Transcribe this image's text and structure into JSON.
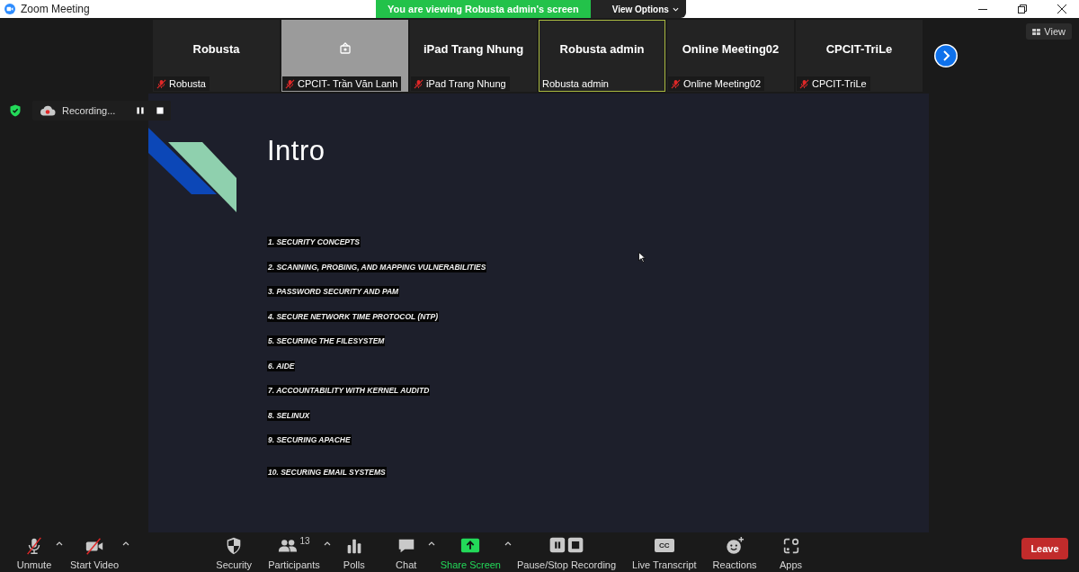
{
  "window": {
    "title": "Zoom Meeting"
  },
  "banner": {
    "message": "You are viewing Robusta admin's screen",
    "options": "View Options"
  },
  "view_button": {
    "label": "View"
  },
  "participants": [
    {
      "kind": "name",
      "name": "Robusta",
      "label": "Robusta",
      "muted": true,
      "speaking": false
    },
    {
      "kind": "video",
      "label": "CPCIT- Trần Văn Lanh",
      "muted": true,
      "speaking": false
    },
    {
      "kind": "name",
      "name": "iPad Trang Nhung",
      "label": "iPad Trang Nhung",
      "muted": true,
      "speaking": false
    },
    {
      "kind": "name",
      "name": "Robusta admin",
      "label": "Robusta admin",
      "muted": false,
      "speaking": true
    },
    {
      "kind": "name",
      "name": "Online Meeting02",
      "label": "Online Meeting02",
      "muted": true,
      "speaking": false
    },
    {
      "kind": "name",
      "name": "CPCIT-TriLe",
      "label": "CPCIT-TriLe",
      "muted": true,
      "speaking": false
    }
  ],
  "recording": {
    "label": "Recording..."
  },
  "slide": {
    "title": "Intro",
    "items": [
      "1. SECURITY CONCEPTS",
      "2. SCANNING, PROBING, AND MAPPING VULNERABILITIES",
      "3. PASSWORD SECURITY AND PAM",
      "4. SECURE NETWORK TIME PROTOCOL (NTP)",
      "5. SECURING THE FILESYSTEM",
      "6. AIDE",
      "7. ACCOUNTABILITY WITH KERNEL AUDITD",
      "8. SELINUX",
      "9. SECURING APACHE",
      "10. SECURING EMAIL SYSTEMS"
    ]
  },
  "toolbar": {
    "left": [
      {
        "kind": "mic",
        "label": "Unmute",
        "menu": true,
        "active": false
      },
      {
        "kind": "video",
        "label": "Start Video",
        "menu": true,
        "active": false
      }
    ],
    "center": [
      {
        "kind": "security",
        "label": "Security",
        "menu": false,
        "active": false
      },
      {
        "kind": "participants",
        "label": "Participants",
        "count": "13",
        "menu": true,
        "active": false
      },
      {
        "kind": "polls",
        "label": "Polls",
        "menu": false,
        "active": false
      },
      {
        "kind": "chat",
        "label": "Chat",
        "menu": true,
        "active": false
      },
      {
        "kind": "share",
        "label": "Share Screen",
        "menu": true,
        "active": true
      },
      {
        "kind": "record",
        "label": "Pause/Stop Recording",
        "menu": false,
        "active": false
      },
      {
        "kind": "cc",
        "label": "Live Transcript",
        "badge": "CC",
        "menu": false,
        "active": false
      },
      {
        "kind": "reactions",
        "label": "Reactions",
        "menu": false,
        "active": false
      },
      {
        "kind": "apps",
        "label": "Apps",
        "menu": false,
        "active": false
      }
    ],
    "leave": "Leave"
  }
}
